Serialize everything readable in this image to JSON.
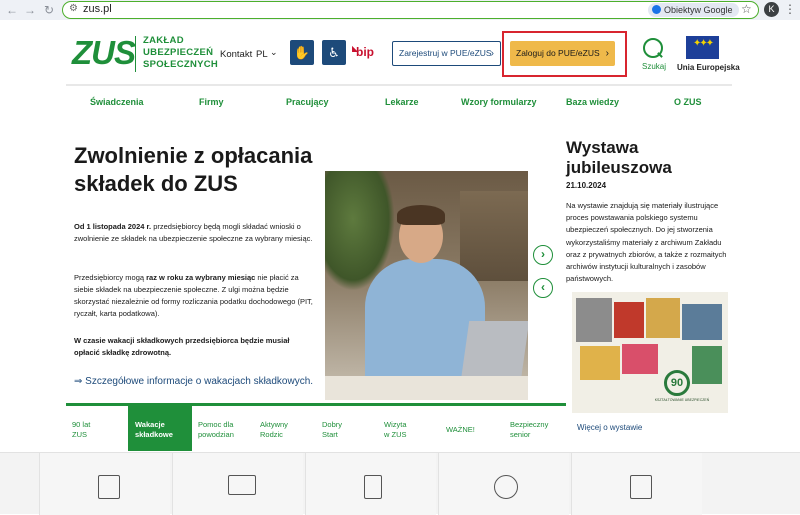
{
  "browser": {
    "url": "zus.pl",
    "lens_label": "Obiektyw Google",
    "profile_initial": "K"
  },
  "header": {
    "logo": "ZUS",
    "logo_text": [
      "ZAKŁAD",
      "UBEZPIECZEŃ",
      "SPOŁECZNYCH"
    ],
    "contact": "Kontakt",
    "language": "PL",
    "bip": "bip",
    "register_label": "Zarejestruj w PUE/eZUS",
    "login_label": "Zaloguj do PUE/eZUS",
    "search_label": "Szukaj",
    "eu_label": "Unia Europejska"
  },
  "nav": [
    "Świadczenia",
    "Firmy",
    "Pracujący",
    "Lekarze",
    "Wzory formularzy",
    "Baza wiedzy",
    "O ZUS"
  ],
  "hero": {
    "title": "Zwolnienie z opłacania składek do ZUS",
    "p1_bold": "Od 1 listopada 2024 r.",
    "p1": " przedsiębiorcy będą mogli składać wnioski o zwolnienie ze składek na ubezpieczenie społeczne za wybrany miesiąc.",
    "p2_a": "Przedsiębiorcy mogą ",
    "p2_bold": "raz w roku za wybrany miesiąc",
    "p2_b": " nie płacić za siebie składek na ubezpieczenie społeczne. Z ulgi można będzie skorzystać niezależnie od formy rozliczania podatku dochodowego (PIT, ryczałt, karta podatkowa).",
    "p3_bold": "W czasie wakacji składkowych przedsiębiorca będzie musiał opłacić składkę zdrowotną.",
    "link": "⇒ Szczegółowe informacje o wakacjach składkowych."
  },
  "side": {
    "title": "Wystawa jubileuszowa",
    "date": "21.10.2024",
    "text": "Na wystawie znajdują się materiały ilustrujące proces powstawania polskiego systemu ubezpieczeń społecznych. Do jej stworzenia wykorzystaliśmy materiały z archiwum Zakładu oraz z prywatnych zbiorów, a także z rozmaitych archiwów instytucji kulturalnych i zasobów państwowych.",
    "badge": "90",
    "caption": "KSZTAŁTOWANIE UBEZPIECZEŃ",
    "more": "Więcej o wystawie"
  },
  "tabs": [
    {
      "label": "90 lat\nZUS",
      "active": false
    },
    {
      "label": "Wakacje\nskładkowe",
      "active": true
    },
    {
      "label": "Pomoc dla\npowodzian",
      "active": false
    },
    {
      "label": "Aktywny\nRodzic",
      "active": false
    },
    {
      "label": "Dobry\nStart",
      "active": false
    },
    {
      "label": "Wizyta\nw ZUS",
      "active": false
    },
    {
      "label": "WAŻNE!",
      "active": false
    },
    {
      "label": "Bezpieczny\nsenior",
      "active": false
    }
  ],
  "colors": {
    "brand_green": "#1f8f3a",
    "navy": "#1d4a7a",
    "login_yellow": "#efb94a",
    "highlight_red": "#d8252f"
  }
}
